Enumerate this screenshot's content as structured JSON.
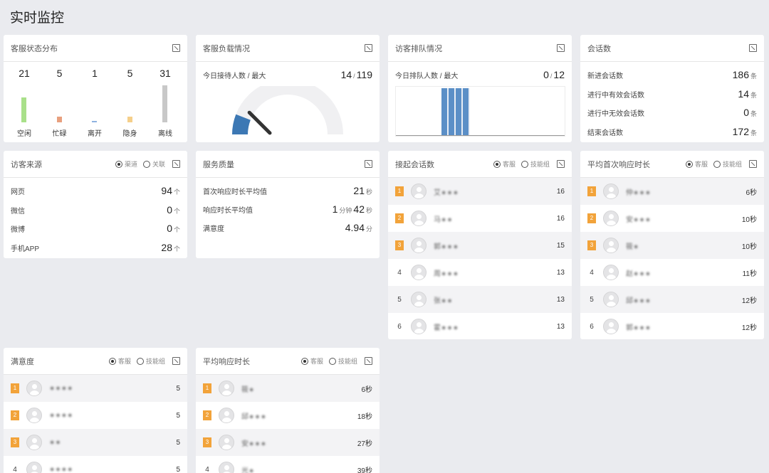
{
  "page_title": "实时监控",
  "agent_status": {
    "title": "客服状态分布",
    "items": [
      {
        "label": "空闲",
        "value": "21",
        "color": "#a9e08a"
      },
      {
        "label": "忙碌",
        "value": "5",
        "color": "#e8a07e"
      },
      {
        "label": "离开",
        "value": "1",
        "color": "#8fb2e0"
      },
      {
        "label": "隐身",
        "value": "5",
        "color": "#f5cf8a"
      },
      {
        "label": "离线",
        "value": "31",
        "color": "#c8c8c8"
      }
    ]
  },
  "agent_load": {
    "title": "客服负载情况",
    "label": "今日接待人数 / 最大",
    "current": "14",
    "sep": "/",
    "max": "119",
    "fraction": 0.118
  },
  "visitor_queue": {
    "title": "访客排队情况",
    "label": "今日排队人数 / 最大",
    "current": "0",
    "sep": "/",
    "max": "12"
  },
  "sessions": {
    "title": "会话数",
    "rows": [
      {
        "label": "新进会话数",
        "value": "186",
        "unit": "条"
      },
      {
        "label": "进行中有效会话数",
        "value": "14",
        "unit": "条"
      },
      {
        "label": "进行中无效会话数",
        "value": "0",
        "unit": "条"
      },
      {
        "label": "结束会话数",
        "value": "172",
        "unit": "条"
      }
    ]
  },
  "visitor_source": {
    "title": "访客来源",
    "radio": [
      "渠道",
      "关联"
    ],
    "rows": [
      {
        "label": "网页",
        "value": "94",
        "unit": "个"
      },
      {
        "label": "微信",
        "value": "0",
        "unit": "个"
      },
      {
        "label": "微博",
        "value": "0",
        "unit": "个"
      },
      {
        "label": "手机APP",
        "value": "28",
        "unit": "个"
      }
    ]
  },
  "service_quality": {
    "title": "服务质量",
    "rows": [
      {
        "label": "首次响应时长平均值",
        "value": "21",
        "unit": "秒"
      },
      {
        "label": "响应时长平均值",
        "value_min": "1",
        "mid": "分钟",
        "value": "42",
        "unit": "秒"
      },
      {
        "label": "满意度",
        "value": "4.94",
        "unit": "分"
      }
    ]
  },
  "accepted_sessions": {
    "title": "接起会话数",
    "radio": [
      "客服",
      "技能组"
    ],
    "rows": [
      {
        "rank": "1",
        "name": "艾∗∗∗",
        "value": "16"
      },
      {
        "rank": "2",
        "name": "马∗∗",
        "value": "16"
      },
      {
        "rank": "3",
        "name": "郭∗∗∗",
        "value": "15"
      },
      {
        "rank": "4",
        "name": "周∗∗∗",
        "value": "13"
      },
      {
        "rank": "5",
        "name": "张∗∗",
        "value": "13"
      },
      {
        "rank": "6",
        "name": "霍∗∗∗",
        "value": "13"
      }
    ]
  },
  "first_response": {
    "title": "平均首次响应时长",
    "radio": [
      "客服",
      "技能组"
    ],
    "rows": [
      {
        "rank": "1",
        "name": "仲∗∗∗",
        "value": "6秒"
      },
      {
        "rank": "2",
        "name": "安∗∗∗",
        "value": "10秒"
      },
      {
        "rank": "3",
        "name": "筱∗",
        "value": "10秒"
      },
      {
        "rank": "4",
        "name": "赵∗∗∗",
        "value": "11秒"
      },
      {
        "rank": "5",
        "name": "邱∗∗∗",
        "value": "12秒"
      },
      {
        "rank": "6",
        "name": "郭∗∗∗",
        "value": "12秒"
      }
    ]
  },
  "satisfaction": {
    "title": "满意度",
    "radio": [
      "客服",
      "技能组"
    ],
    "rows": [
      {
        "rank": "1",
        "name": "∗∗∗∗",
        "value": "5"
      },
      {
        "rank": "2",
        "name": "∗∗∗∗",
        "value": "5"
      },
      {
        "rank": "3",
        "name": "∗∗",
        "value": "5"
      },
      {
        "rank": "4",
        "name": "∗∗∗∗",
        "value": "5"
      }
    ]
  },
  "avg_response": {
    "title": "平均响应时长",
    "radio": [
      "客服",
      "技能组"
    ],
    "rows": [
      {
        "rank": "1",
        "name": "筱∗",
        "value": "6秒"
      },
      {
        "rank": "2",
        "name": "邱∗∗∗",
        "value": "18秒"
      },
      {
        "rank": "3",
        "name": "安∗∗∗",
        "value": "27秒"
      },
      {
        "rank": "4",
        "name": "光∗",
        "value": "39秒"
      }
    ]
  }
}
